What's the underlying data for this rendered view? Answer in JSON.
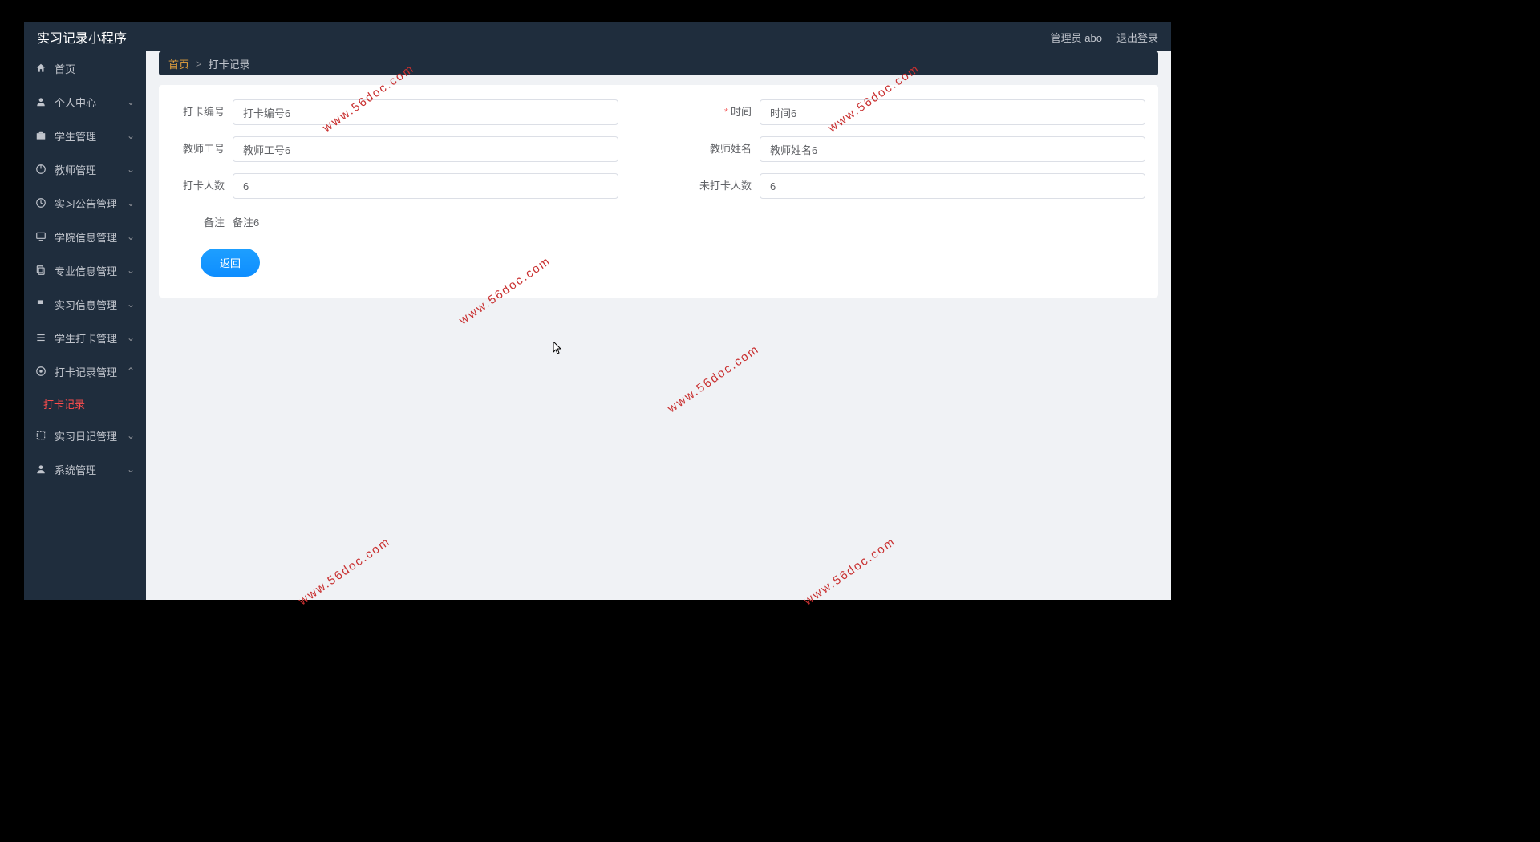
{
  "app_title": "实习记录小程序",
  "header_user": "管理员 abo",
  "header_logout": "退出登录",
  "sidebar": {
    "items": [
      {
        "label": "首页",
        "icon": "home",
        "expandable": false
      },
      {
        "label": "个人中心",
        "icon": "user",
        "expandable": true
      },
      {
        "label": "学生管理",
        "icon": "case",
        "expandable": true
      },
      {
        "label": "教师管理",
        "icon": "power",
        "expandable": true
      },
      {
        "label": "实习公告管理",
        "icon": "clock",
        "expandable": true
      },
      {
        "label": "学院信息管理",
        "icon": "monitor",
        "expandable": true
      },
      {
        "label": "专业信息管理",
        "icon": "copy",
        "expandable": true
      },
      {
        "label": "实习信息管理",
        "icon": "flag",
        "expandable": true
      },
      {
        "label": "学生打卡管理",
        "icon": "list",
        "expandable": true
      },
      {
        "label": "打卡记录管理",
        "icon": "target",
        "expandable": true,
        "expanded": true
      },
      {
        "label": "实习日记管理",
        "icon": "expand",
        "expandable": true
      },
      {
        "label": "系统管理",
        "icon": "person",
        "expandable": true
      }
    ],
    "submenu_active": "打卡记录"
  },
  "breadcrumb": {
    "home": "首页",
    "current": "打卡记录"
  },
  "form": {
    "id_label": "打卡编号",
    "id_value": "打卡编号6",
    "time_label": "时间",
    "time_value": "时间6",
    "teacher_id_label": "教师工号",
    "teacher_id_value": "教师工号6",
    "teacher_name_label": "教师姓名",
    "teacher_name_value": "教师姓名6",
    "checkin_count_label": "打卡人数",
    "checkin_count_value": "6",
    "missed_count_label": "未打卡人数",
    "missed_count_value": "6",
    "remark_label": "备注",
    "remark_value": "备注6",
    "back_button": "返回"
  },
  "watermark_text": "www.56doc.com"
}
